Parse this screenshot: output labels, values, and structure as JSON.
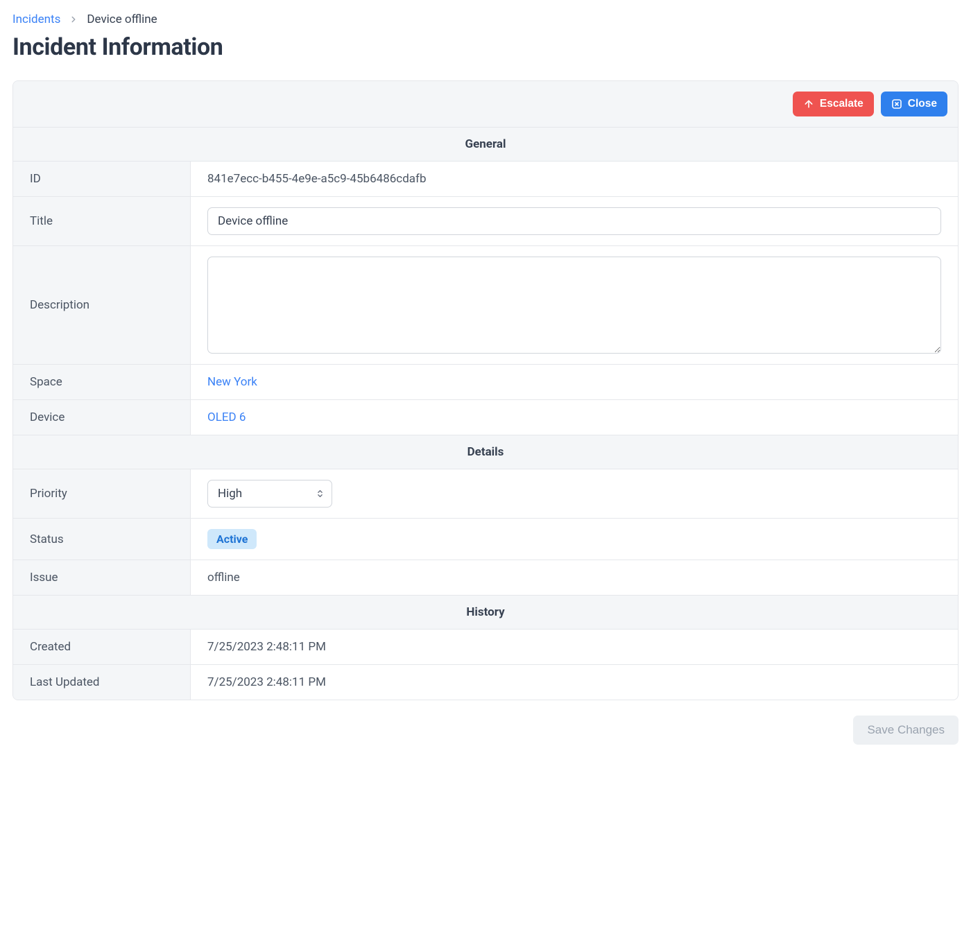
{
  "breadcrumb": {
    "root": "Incidents",
    "current": "Device offline"
  },
  "page_title": "Incident Information",
  "toolbar": {
    "escalate_label": "Escalate",
    "close_label": "Close"
  },
  "sections": {
    "general_header": "General",
    "details_header": "Details",
    "history_header": "History"
  },
  "general": {
    "id_label": "ID",
    "id_value": "841e7ecc-b455-4e9e-a5c9-45b6486cdafb",
    "title_label": "Title",
    "title_value": "Device offline",
    "description_label": "Description",
    "description_value": "",
    "space_label": "Space",
    "space_value": "New York",
    "device_label": "Device",
    "device_value": "OLED 6"
  },
  "details": {
    "priority_label": "Priority",
    "priority_value": "High",
    "status_label": "Status",
    "status_value": "Active",
    "issue_label": "Issue",
    "issue_value": "offline"
  },
  "history": {
    "created_label": "Created",
    "created_value": "7/25/2023 2:48:11 PM",
    "updated_label": "Last Updated",
    "updated_value": "7/25/2023 2:48:11 PM"
  },
  "footer": {
    "save_label": "Save Changes"
  }
}
